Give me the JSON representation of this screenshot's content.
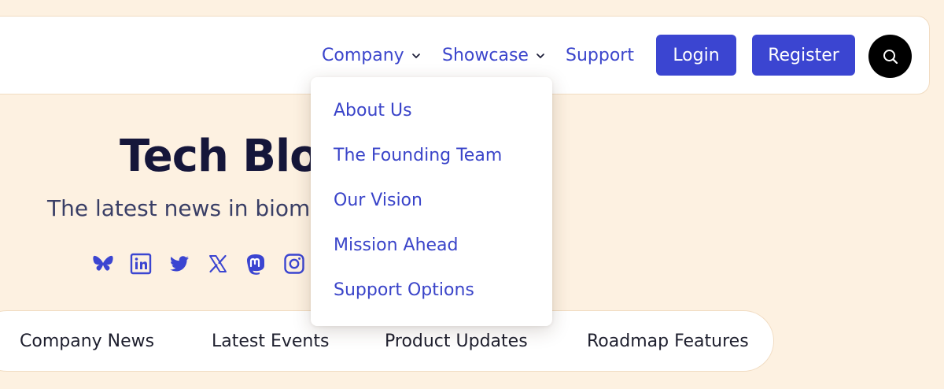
{
  "nav": {
    "company_label": "Company",
    "showcase_label": "Showcase",
    "support_label": "Support",
    "login_label": "Login",
    "register_label": "Register"
  },
  "hero": {
    "title": "Tech Blog",
    "subtitle": "The latest news in biomed"
  },
  "socials": [
    "bluesky-icon",
    "linkedin-icon",
    "twitter-icon",
    "x-icon",
    "mastodon-icon",
    "instagram-icon"
  ],
  "tabs": [
    "Company News",
    "Latest Events",
    "Product Updates",
    "Roadmap Features"
  ],
  "dropdown": {
    "items": [
      "About Us",
      "The Founding Team",
      "Our Vision",
      "Mission Ahead",
      "Support Options"
    ]
  },
  "colors": {
    "background": "#fdf1e1",
    "accent": "#3b45d1",
    "link": "#3c46cc",
    "heading": "#15163a"
  }
}
